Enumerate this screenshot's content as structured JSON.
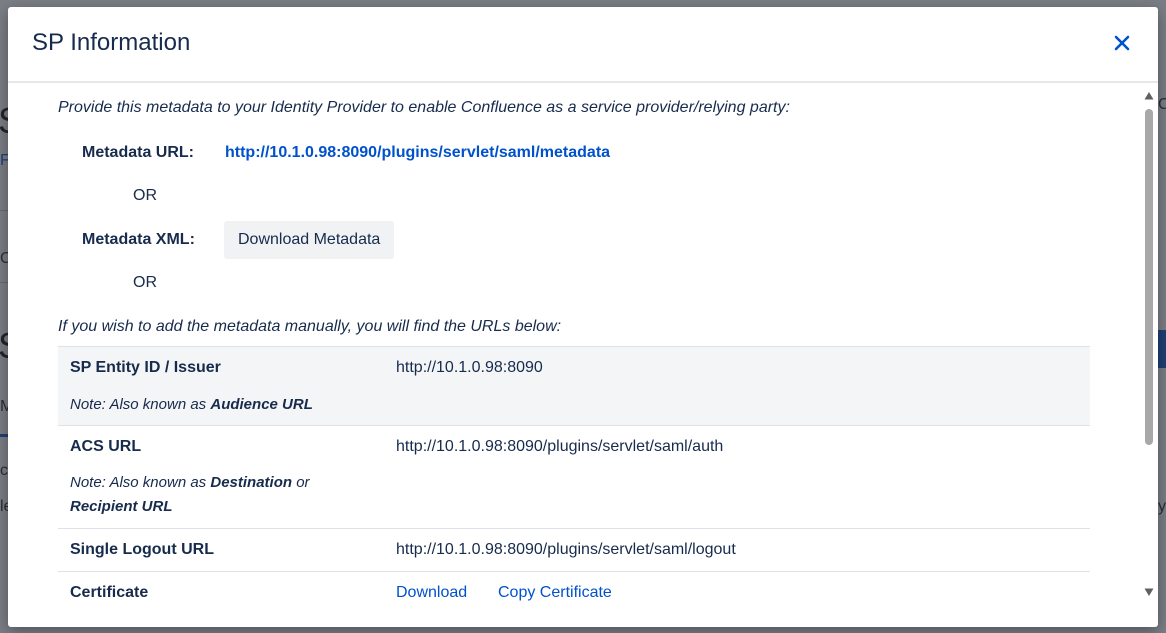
{
  "background": {
    "frag_left_big": "S",
    "frag_left_small_1": "F",
    "frag_left_small_2": "C",
    "frag_left_big_2": "S",
    "frag_left_small_3": "M",
    "frag_left_small_4": "cl",
    "frag_left_small_5": "le",
    "frag_right_1": "Co",
    "frag_right_2": "y"
  },
  "modal": {
    "title": "SP Information",
    "intro": "Provide this metadata to your Identity Provider to enable Confluence as a service provider/relying party:",
    "metadata_url_label": "Metadata URL:",
    "metadata_url": "http://10.1.0.98:8090/plugins/servlet/saml/metadata",
    "or_1": "OR",
    "metadata_xml_label": "Metadata XML:",
    "download_metadata_button": "Download Metadata",
    "or_2": "OR",
    "manual_text": "If you wish to add the metadata manually, you will find the URLs below:",
    "rows": [
      {
        "label": "SP Entity ID / Issuer",
        "value": "http://10.1.0.98:8090",
        "note_prefix": "Note: Also known as ",
        "note_bold": "Audience URL",
        "note_mid": "",
        "note_bold_2": ""
      },
      {
        "label": "ACS URL",
        "value": "http://10.1.0.98:8090/plugins/servlet/saml/auth",
        "note_prefix": "Note: Also known as ",
        "note_bold": "Destination",
        "note_mid": " or ",
        "note_bold_2": "Recipient URL"
      },
      {
        "label": "Single Logout URL",
        "value": "http://10.1.0.98:8090/plugins/servlet/saml/logout"
      },
      {
        "label": "Certificate",
        "link_1": "Download",
        "link_2": "Copy Certificate"
      }
    ]
  },
  "colors": {
    "link": "#0052cc",
    "text": "#172b4d",
    "shaded_row": "#f4f5f7"
  },
  "icons": {
    "close": "close-icon",
    "scroll_up": "triangle-up-icon",
    "scroll_down": "triangle-down-icon"
  }
}
